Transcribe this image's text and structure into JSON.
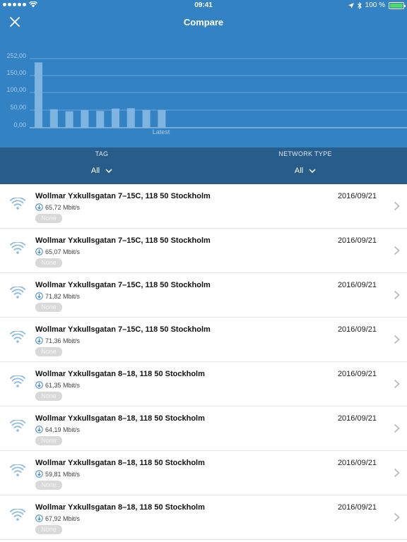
{
  "status": {
    "time": "09:41",
    "battery": "100 %"
  },
  "header": {
    "title": "Compare"
  },
  "chart_data": {
    "type": "bar",
    "y_ticks": [
      "252,00",
      "150,00",
      "100,00",
      "50,00",
      "0,00"
    ],
    "ylim": [
      0,
      252
    ],
    "values": [
      229,
      53,
      47,
      50,
      48,
      55,
      56,
      51,
      51
    ],
    "x_label_latest": "Latest",
    "grid": true
  },
  "filters": [
    {
      "label": "TAG",
      "value": "All"
    },
    {
      "label": "NETWORK TYPE",
      "value": "All"
    }
  ],
  "results": [
    {
      "address": "Wollmar Yxkullsgatan 7–15C, 118 50 Stockholm",
      "speed": "65,72 Mbit/s",
      "date": "2016/09/21",
      "tag": "None"
    },
    {
      "address": "Wollmar Yxkullsgatan 7–15C, 118 50 Stockholm",
      "speed": "65,07 Mbit/s",
      "date": "2016/09/21",
      "tag": "None"
    },
    {
      "address": "Wollmar Yxkullsgatan 7–15C, 118 50 Stockholm",
      "speed": "71,82 Mbit/s",
      "date": "2016/09/21",
      "tag": "None"
    },
    {
      "address": "Wollmar Yxkullsgatan 7–15C, 118 50 Stockholm",
      "speed": "71,36 Mbit/s",
      "date": "2016/09/21",
      "tag": "None"
    },
    {
      "address": "Wollmar Yxkullsgatan 8–18, 118 50 Stockholm",
      "speed": "61,35 Mbit/s",
      "date": "2016/09/21",
      "tag": "None"
    },
    {
      "address": "Wollmar Yxkullsgatan 8–18, 118 50 Stockholm",
      "speed": "64,19 Mbit/s",
      "date": "2016/09/21",
      "tag": "None"
    },
    {
      "address": "Wollmar Yxkullsgatan 8–18, 118 50 Stockholm",
      "speed": "59,81 Mbit/s",
      "date": "2016/09/21",
      "tag": "None"
    },
    {
      "address": "Wollmar Yxkullsgatan 8–18, 118 50 Stockholm",
      "speed": "67,92 Mbit/s",
      "date": "2016/09/21",
      "tag": "None"
    }
  ]
}
